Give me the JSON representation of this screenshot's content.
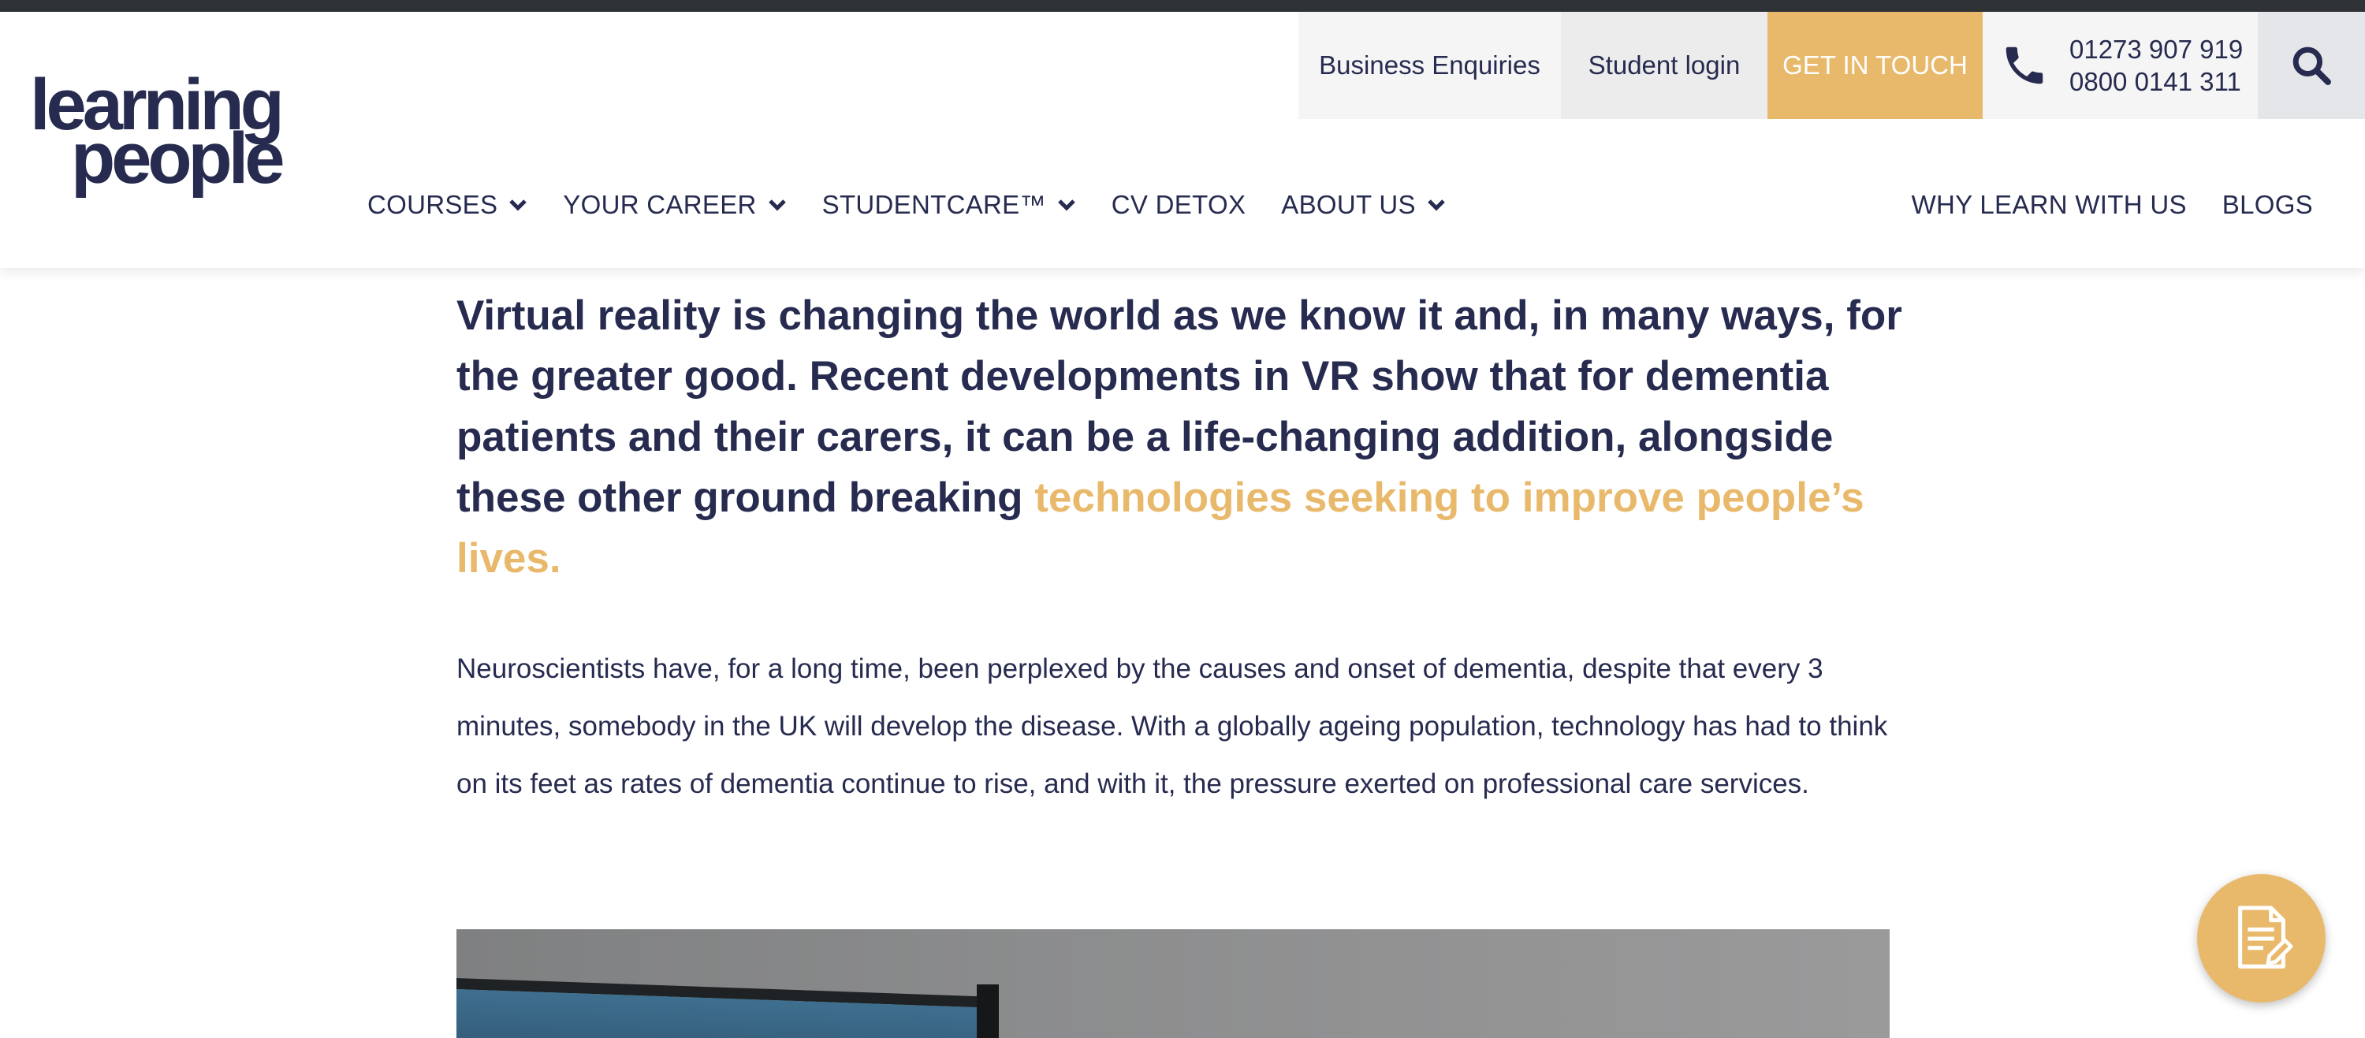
{
  "brand": {
    "logo_line1": "learning",
    "logo_line2": "people",
    "navy": "#262b4f",
    "accent": "#e9b96b"
  },
  "utility_bar": {
    "business": "Business Enquiries",
    "student_login": "Student login",
    "get_in_touch": "GET IN TOUCH",
    "phone_icon": "phone-icon",
    "phone_1": "01273 907 919",
    "phone_2": "0800 0141 311",
    "search_icon": "search-icon"
  },
  "main_nav": {
    "items": [
      {
        "label": "COURSES",
        "dropdown": true
      },
      {
        "label": "YOUR CAREER",
        "dropdown": true
      },
      {
        "label": "STUDENTCARE™",
        "dropdown": true
      },
      {
        "label": "CV DETOX",
        "dropdown": false
      },
      {
        "label": "ABOUT US",
        "dropdown": true
      }
    ],
    "right_items": [
      {
        "label": "WHY LEARN WITH US"
      },
      {
        "label": "BLOGS"
      }
    ]
  },
  "article": {
    "lead_text": "Virtual reality is changing the world as we know it and, in many ways, for the greater good. Recent developments in VR show that for dementia patients and their carers, it can be a life-changing addition, alongside these other ground breaking ",
    "lead_link": "technologies seeking to improve people’s lives.",
    "body_paragraph": "Neuroscientists have, for a long time, been perplexed by the causes and onset of dementia, despite that every 3 minutes, somebody in the UK will develop the disease. With a globally ageing population, technology has had to think on its feet as rates of dementia continue to rise, and with it, the pressure exerted on professional care services."
  },
  "floating_button": {
    "icon": "document-edit-icon"
  }
}
